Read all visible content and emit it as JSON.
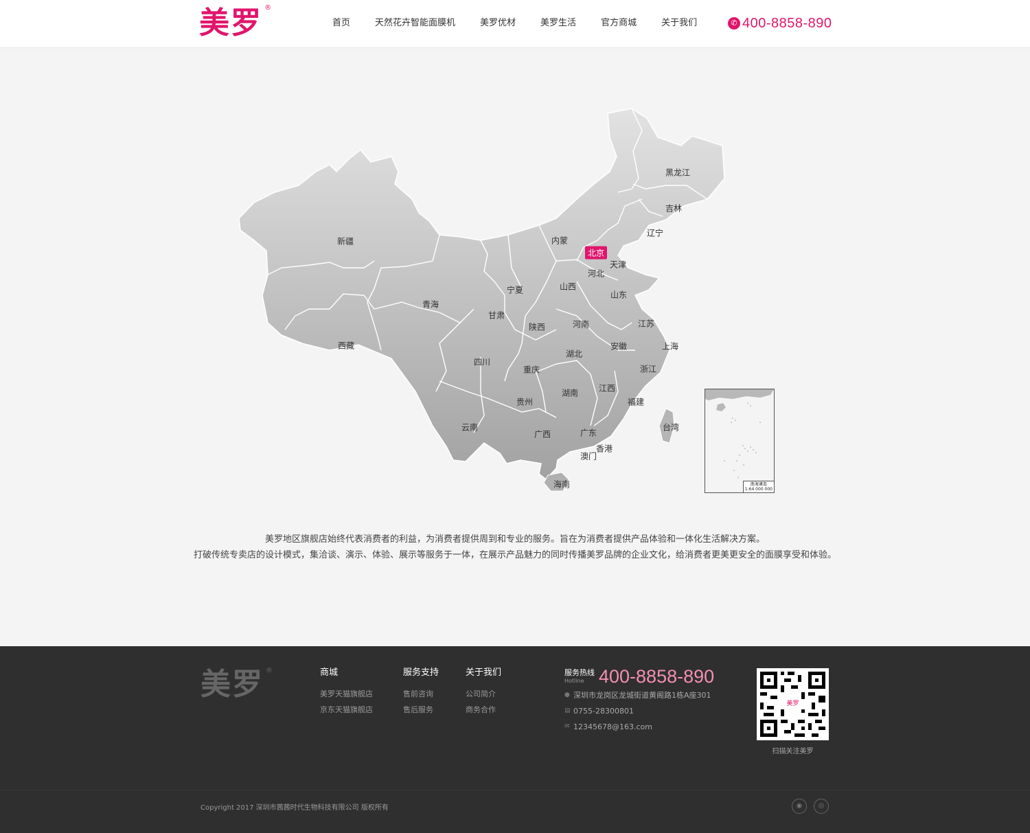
{
  "brand": {
    "logo_text": "美罗",
    "reg_mark": "®",
    "color": "#e0156b"
  },
  "nav": {
    "items": [
      "首页",
      "天然花卉智能面膜机",
      "美罗优材",
      "美罗生活",
      "官方商城",
      "关于我们"
    ],
    "hotline": "400-8858-890",
    "phone_icon": "phone-icon"
  },
  "map": {
    "provinces": [
      "黑龙江",
      "吉林",
      "辽宁",
      "内蒙",
      "北京",
      "天津",
      "河北",
      "新疆",
      "宁夏",
      "山西",
      "山东",
      "青海",
      "甘肃",
      "陕西",
      "河南",
      "江苏",
      "西藏",
      "安徽",
      "上海",
      "四川",
      "湖北",
      "重庆",
      "浙江",
      "江西",
      "湖南",
      "贵州",
      "福建",
      "云南",
      "广西",
      "广东",
      "台湾",
      "香港",
      "澳门",
      "海南"
    ],
    "active": "北京",
    "inset_label_1": "南海诸岛",
    "inset_label_2": "1:64 000 000"
  },
  "description": {
    "line1": "美罗地区旗舰店始终代表消费者的利益，为消费者提供周到和专业的服务。旨在为消费者提供产品体验和一体化生活解决方案。",
    "line2": "打破传统专卖店的设计模式，集洽谈、演示、体验、展示等服务于一体，在展示产品魅力的同时传播美罗品牌的企业文化，给消费者更美更安全的面膜享受和体验。"
  },
  "footer": {
    "logo_text": "美罗",
    "reg_mark": "®",
    "columns": [
      {
        "title": "商城",
        "links": [
          "美罗天猫旗舰店",
          "京东天猫旗舰店"
        ]
      },
      {
        "title": "服务支持",
        "links": [
          "售前咨询",
          "售后服务"
        ]
      },
      {
        "title": "关于我们",
        "links": [
          "公司简介",
          "商务合作"
        ]
      }
    ],
    "service_label": "服务热线",
    "service_sub": "Hotline",
    "service_number": "400-8858-890",
    "address": "深圳市龙岗区龙城街道黄阁路1栋A座301",
    "fax": "0755-28300801",
    "email": "12345678@163.com",
    "qr_center": "美罗",
    "qr_caption": "扫描关注美罗",
    "copyright": "Copyright 2017  深圳市茜茜时代生物科技有限公司  版权所有",
    "social_icons": [
      "wechat-icon",
      "weibo-icon"
    ]
  }
}
